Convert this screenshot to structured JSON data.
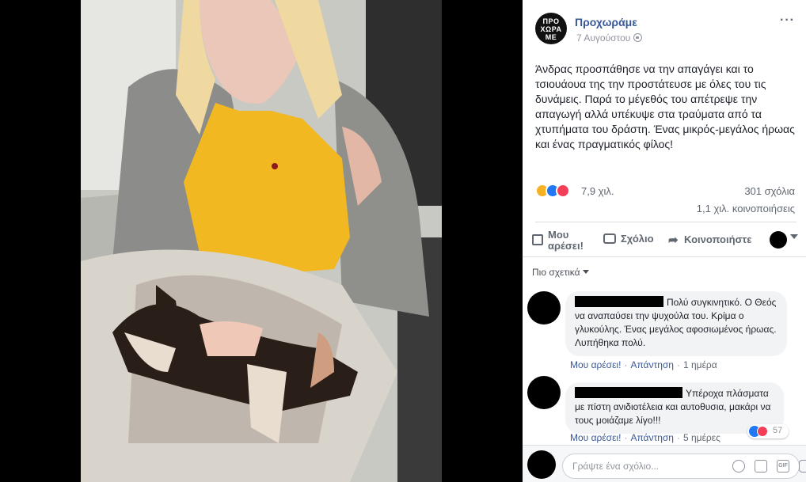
{
  "post": {
    "page_name": "Προχωράμε",
    "logo_lines": [
      "ΠΡΟ",
      "ΧΩΡΑ",
      "ΜΕ"
    ],
    "date": "7 Αυγούστου",
    "text": "Άνδρας προσπάθησε να την απαγάγει και το τσιουάουα της την προστάτευσε με όλες του τις δυνάμεις. Παρά το μέγεθός του απέτρεψε την απαγωγή αλλά υπέκυψε στα τραύματα από τα χτυπήματα του δράστη. Ένας μικρός-μεγάλος ήρωας και ένας πραγματικός φίλος!",
    "more_icon": "···",
    "reactions_count": "7,9 χιλ.",
    "comments_count": "301 σχόλια",
    "shares_count": "1,1 χιλ. κοινοποιήσεις"
  },
  "actions": {
    "like": "Μου αρέσει!",
    "comment": "Σχόλιο",
    "share": "Κοινοποιήστε"
  },
  "filter_label": "Πιο σχετικά",
  "comments": [
    {
      "text": "Πολύ συγκινητικό. Ο Θεός να αναπαύσει την ψυχούλα του. Κρίμα ο γλυκούλης. Ένας μεγάλος αφοσιωμένος ήρωας. Λυπήθηκα πολύ.",
      "like": "Μου αρέσει!",
      "reply": "Απάντηση",
      "time": "1 ημέρα"
    },
    {
      "text": "Υπέροχα πλάσματα με πίστη ανιδιοτέλεια και αυτοθυσια, μακάρι να τους μοιάζαμε λίγο!!!",
      "like": "Μου αρέσει!",
      "reply": "Απάντηση",
      "time": "5 ημέρες",
      "reactions": "57"
    }
  ],
  "composer": {
    "placeholder": "Γράψτε ένα σχόλιο...",
    "gif_label": "GIF"
  },
  "colors": {
    "link": "#385898",
    "meta": "#90949c",
    "like_blue": "#2078f4",
    "love_red": "#f33e58",
    "sad_yellow": "#f7b125"
  }
}
